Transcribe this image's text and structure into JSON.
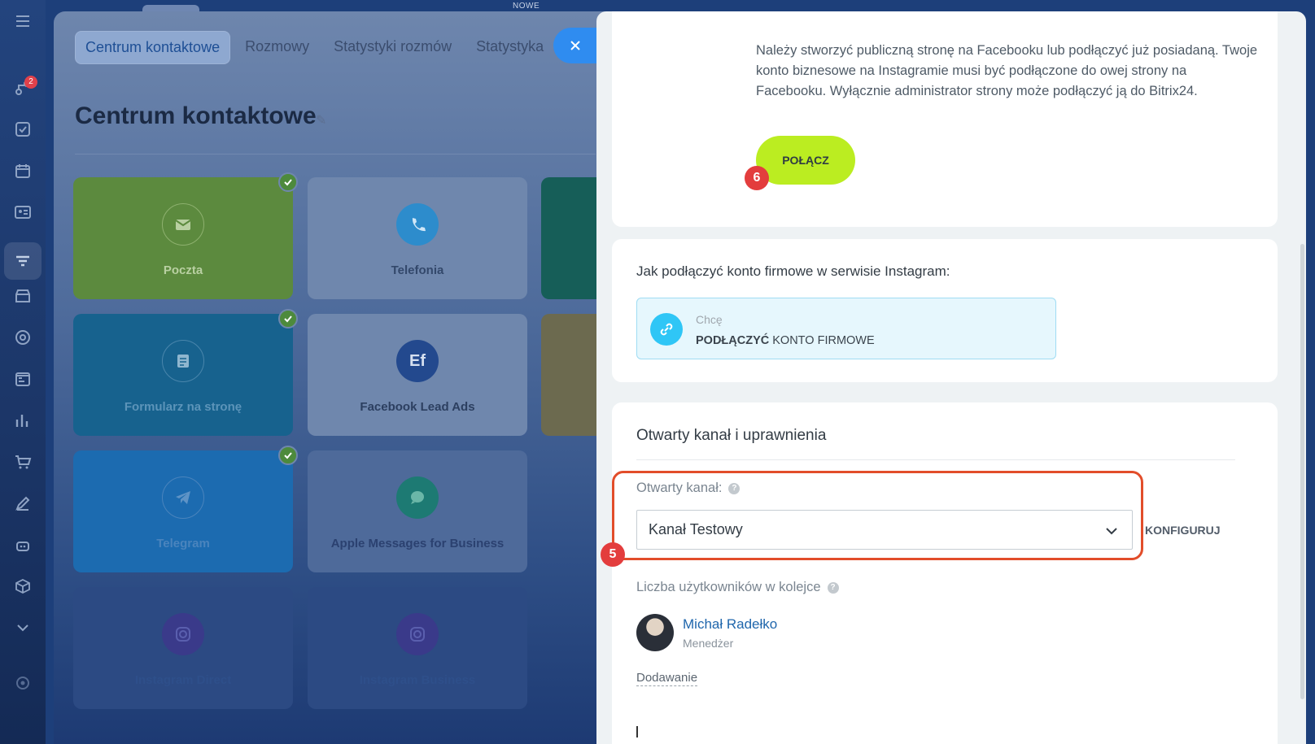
{
  "top_strip": {
    "new_label": "NOWE"
  },
  "sidebar": {
    "badge_count": "2",
    "icons": [
      "menu-icon",
      "pipeline-icon",
      "tasks-icon",
      "calendar-icon",
      "contacts-icon",
      "contact-center-icon",
      "store-icon",
      "target-icon",
      "schedule-icon",
      "analytics-icon",
      "cart-icon",
      "sign-icon",
      "bot-icon",
      "box-icon",
      "chevron-down-icon",
      "settings-icon"
    ]
  },
  "background_page": {
    "tabs": [
      {
        "label": "Centrum kontaktowe",
        "active": true
      },
      {
        "label": "Rozmowy"
      },
      {
        "label": "Statystyki rozmów"
      },
      {
        "label": "Statystyka"
      }
    ],
    "title": "Centrum kontaktowe",
    "tiles": [
      {
        "label": "Poczta",
        "icon": "mail-icon",
        "color": "#5c8a3e",
        "checked": true
      },
      {
        "label": "Telefonia",
        "icon": "phone-icon",
        "color": "#6f87ad",
        "checked": false
      },
      {
        "label": "Formularz na stronę",
        "icon": "form-icon",
        "color": "#17628e",
        "checked": true
      },
      {
        "label": "Facebook Lead Ads",
        "icon": "facebook-lead-ads-icon",
        "color": "#6f87ad",
        "checked": false
      },
      {
        "label": "Telegram",
        "icon": "telegram-icon",
        "color": "#1c6bb0",
        "checked": true
      },
      {
        "label": "Apple Messages for Business",
        "icon": "apple-messages-icon",
        "color": "#4e6a9a",
        "checked": false
      },
      {
        "label": "Instagram Direct",
        "icon": "instagram-icon",
        "color": "#2c4a83",
        "checked": false
      },
      {
        "label": "Instagram Business",
        "icon": "instagram-icon",
        "color": "#2c4a83",
        "checked": false
      }
    ]
  },
  "panel": {
    "intro_text": "Należy stworzyć publiczną stronę na Facebooku lub podłączyć już posiadaną. Twoje konto biznesowe na Instagramie musi być podłączone do owej strony na Facebooku. Wyłącznie administrator strony może podłączyć ją do Bitrix24.",
    "connect_button": "POŁĄCZ",
    "step_connect": "6",
    "how_to": {
      "title": "Jak podłączyć konto firmowe w serwisie Instagram:",
      "small": "Chcę",
      "main_bold": "PODŁĄCZYĆ",
      "main_rest": " KONTO FIRMOWE"
    },
    "open_channel": {
      "section_title": "Otwarty kanał i uprawnienia",
      "label": "Otwarty kanał:",
      "selected": "Kanał Testowy",
      "configure": "KONFIGURUJ",
      "step": "5",
      "highlight_color": "#e24d2a"
    },
    "queue": {
      "label": "Liczba użytkowników w kolejce",
      "user_name": "Michał Radełko",
      "user_role": "Menedżer",
      "add_link": "Dodawanie"
    }
  },
  "colors": {
    "accent_green": "#bbed21",
    "step_red": "#e33d3d",
    "link_blue": "#1f66ac",
    "info_cyan": "#2fc6f6"
  }
}
